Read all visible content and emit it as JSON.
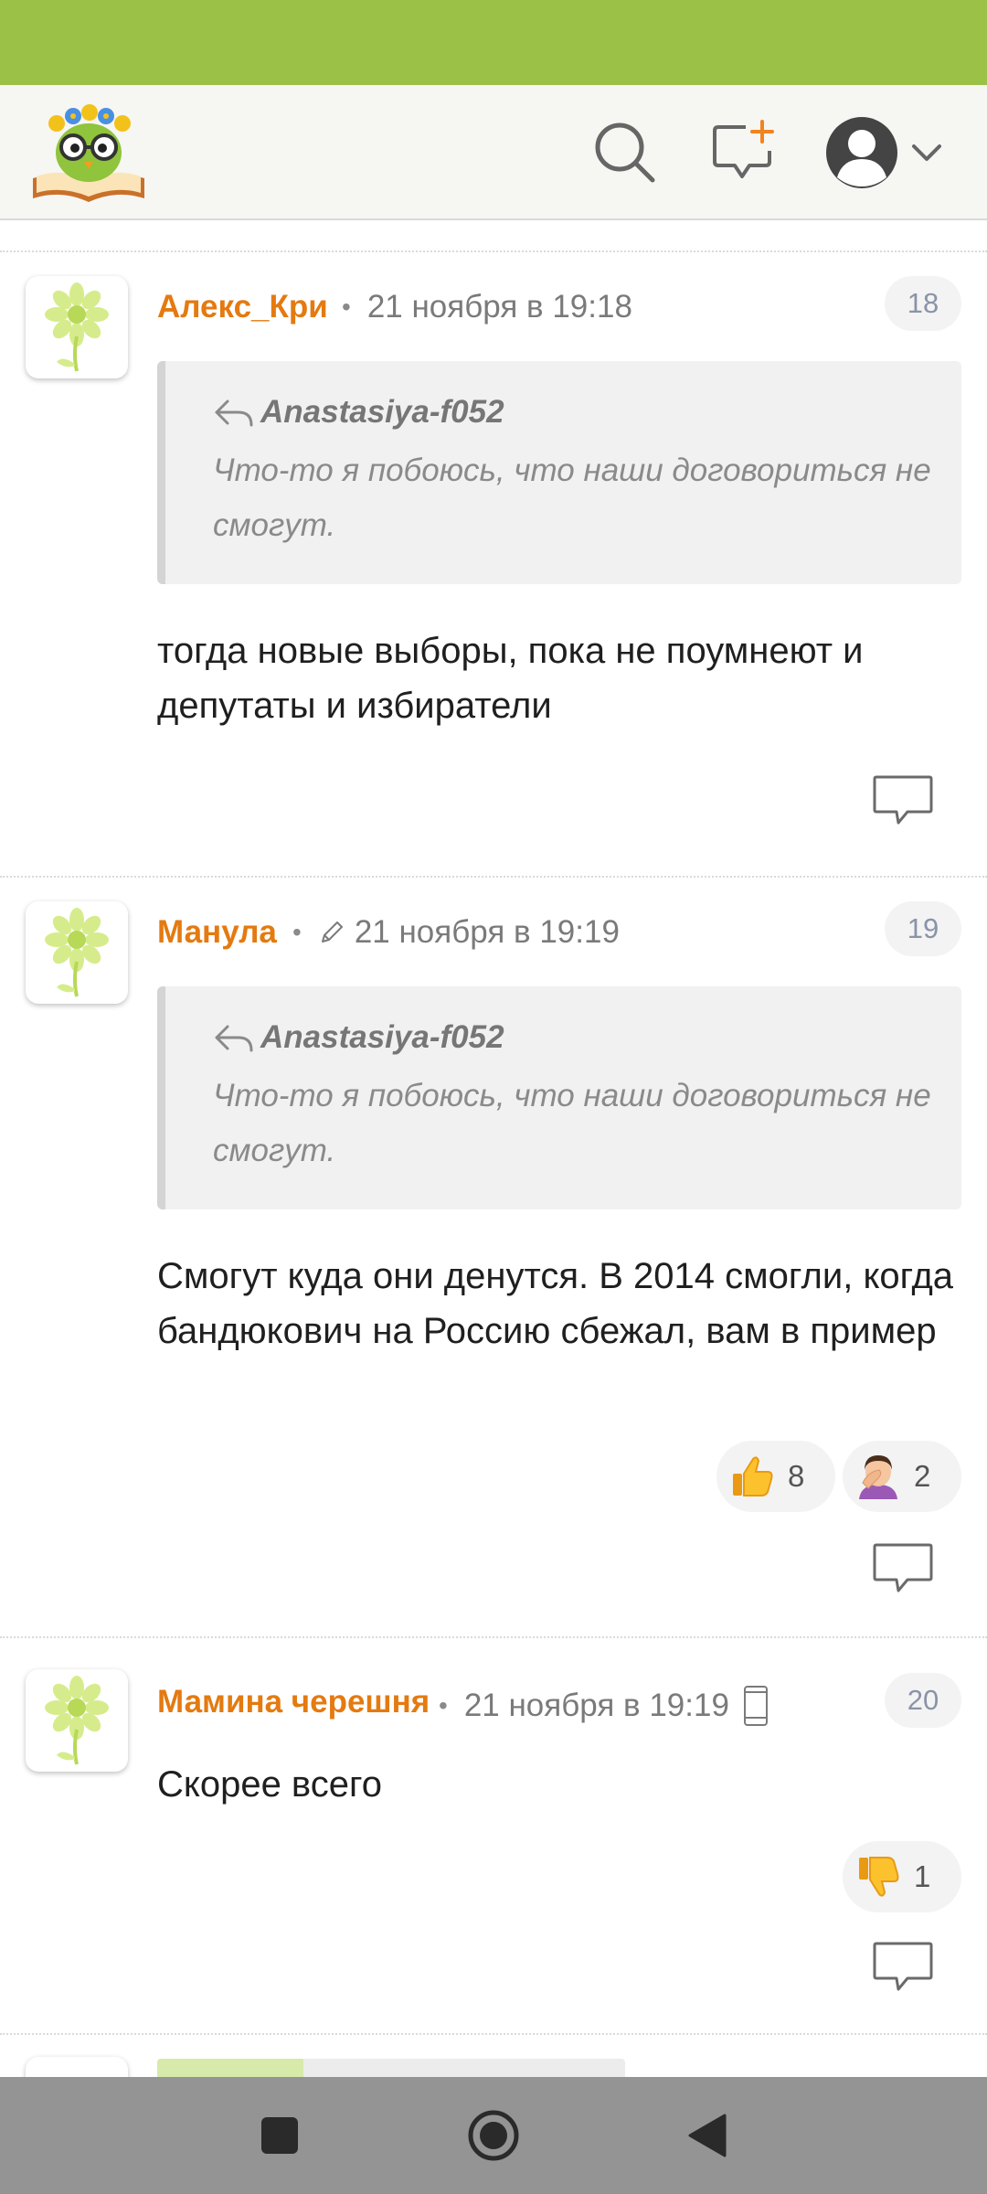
{
  "colors": {
    "statusbar": "#9bc146",
    "author": "#e47a10",
    "header_bg": "#f6f6f3",
    "navbar": "#949494"
  },
  "header": {
    "logo_icon": "owl-on-book-logo",
    "search_icon": "search-icon",
    "new_comment_icon": "new-comment-icon",
    "profile_icon": "user-avatar-icon"
  },
  "comments": [
    {
      "author": "Алекс_Кри",
      "date": "21 ноября в 19:18",
      "number": "18",
      "quote_author": "Anastasiya-f052",
      "quote_text": "Что-то я побоюсь, что наши договориться не смогут.",
      "text": "тогда новые выборы, пока не поумнеют и депутаты и избиратели"
    },
    {
      "author": "Манула",
      "date": "21 ноября в 19:19",
      "number": "19",
      "quote_author": "Anastasiya-f052",
      "quote_text": "Что-то я побоюсь, что наши договориться не смогут.",
      "text": "Смогут куда они денутся. В 2014 смогли, когда бандюкович на Россию сбежал, вам в пример",
      "reactions": [
        {
          "icon": "thumbs-up",
          "count": "8"
        },
        {
          "icon": "facepalm",
          "count": "2"
        }
      ]
    },
    {
      "author": "Мамина черешня",
      "date": "21 ноября в 19:19",
      "number": "20",
      "text": "Скорее всего",
      "reactions": [
        {
          "icon": "thumbs-down",
          "count": "1"
        }
      ]
    }
  ]
}
